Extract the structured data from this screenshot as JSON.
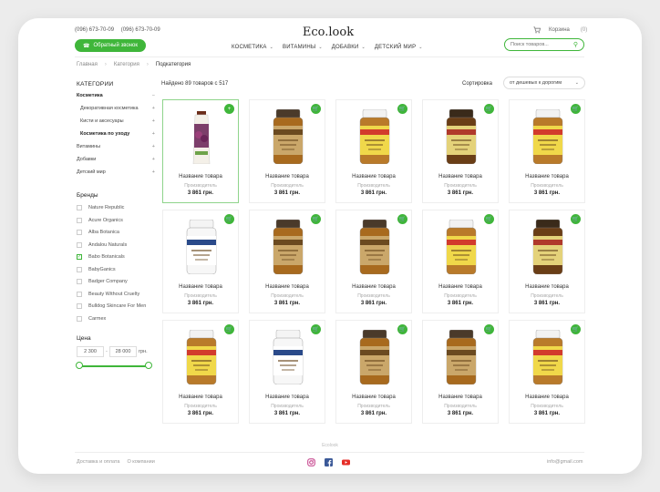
{
  "header": {
    "phones": [
      "(096) 673-70-09",
      "(096) 673-70-09"
    ],
    "callback_label": "Обратный звонок",
    "logo": "Eco.look",
    "cart_label": "Корзина",
    "cart_count": "(0)",
    "search_placeholder": "Поиск товаров..."
  },
  "nav": [
    {
      "label": "КОСМЕТИКА"
    },
    {
      "label": "ВИТАМИНЫ"
    },
    {
      "label": "ДОБАВКИ"
    },
    {
      "label": "ДЕТСКИЙ МИР"
    }
  ],
  "breadcrumb": [
    "Главная",
    "Категория",
    "Подкатегория"
  ],
  "sidebar": {
    "title": "КАТЕГОРИИ",
    "categories": [
      {
        "label": "Косметика",
        "toggle": "−"
      },
      {
        "label": "Декоративная косметика",
        "toggle": "+"
      },
      {
        "label": "Кисти и аксесуары",
        "toggle": "+"
      },
      {
        "label": "Косметика по уходу",
        "toggle": "+"
      },
      {
        "label": "Витамины",
        "toggle": "+"
      },
      {
        "label": "Добавки",
        "toggle": "+"
      },
      {
        "label": "Детский мир",
        "toggle": "+"
      }
    ],
    "brands_title": "Бренды",
    "brands": [
      {
        "label": "Nature Republic",
        "checked": false
      },
      {
        "label": "Acure Organics",
        "checked": false
      },
      {
        "label": "Alba Botanica",
        "checked": false
      },
      {
        "label": "Andalou Naturals",
        "checked": false
      },
      {
        "label": "Babo Botanicals",
        "checked": true
      },
      {
        "label": "BabyGanics",
        "checked": false
      },
      {
        "label": "Badger Company",
        "checked": false
      },
      {
        "label": "Beauty Without Cruelty",
        "checked": false
      },
      {
        "label": "Bulldog Skincare For Men",
        "checked": false
      },
      {
        "label": "Carmex",
        "checked": false
      }
    ],
    "price_title": "Цена",
    "price_min": "2 300",
    "price_max": "28 000",
    "price_unit": "грн."
  },
  "catalog": {
    "found_text": "Найдено 89 товаров с 517",
    "sort_label": "Сортировка",
    "sort_value": "от дешевых к дорогим"
  },
  "products": [
    {
      "name": "Название товара",
      "maker": "Производитель",
      "price": "3 861 грн.",
      "kind": "tube"
    },
    {
      "name": "Название товара",
      "maker": "Производитель",
      "price": "3 861 грн.",
      "kind": "amber"
    },
    {
      "name": "Название товара",
      "maker": "Производитель",
      "price": "3 861 грн.",
      "kind": "yellow"
    },
    {
      "name": "Название товара",
      "maker": "Производитель",
      "price": "3 861 грн.",
      "kind": "dark"
    },
    {
      "name": "Название товара",
      "maker": "Производитель",
      "price": "3 861 грн.",
      "kind": "yellow"
    },
    {
      "name": "Название товара",
      "maker": "Производитель",
      "price": "3 861 грн.",
      "kind": "white"
    },
    {
      "name": "Название товара",
      "maker": "Производитель",
      "price": "3 861 грн.",
      "kind": "amber"
    },
    {
      "name": "Название товара",
      "maker": "Производитель",
      "price": "3 861 грн.",
      "kind": "amber"
    },
    {
      "name": "Название товара",
      "maker": "Производитель",
      "price": "3 861 грн.",
      "kind": "yellow"
    },
    {
      "name": "Название товара",
      "maker": "Производитель",
      "price": "3 861 грн.",
      "kind": "dark"
    },
    {
      "name": "Название товара",
      "maker": "Производитель",
      "price": "3 861 грн.",
      "kind": "yellow"
    },
    {
      "name": "Название товара",
      "maker": "Производитель",
      "price": "3 861 грн.",
      "kind": "white"
    },
    {
      "name": "Название товара",
      "maker": "Производитель",
      "price": "3 861 грн.",
      "kind": "amber"
    },
    {
      "name": "Название товара",
      "maker": "Производитель",
      "price": "3 861 грн.",
      "kind": "amber"
    },
    {
      "name": "Название товара",
      "maker": "Производитель",
      "price": "3 861 грн.",
      "kind": "yellow"
    }
  ],
  "footer": {
    "brand": "Ecolook",
    "links": [
      "Доставка и оплата",
      "О компании"
    ],
    "email": "info@gmail.com",
    "socials": [
      "instagram-icon",
      "facebook-icon",
      "youtube-icon"
    ]
  },
  "colors": {
    "accent": "#3fb63a"
  }
}
